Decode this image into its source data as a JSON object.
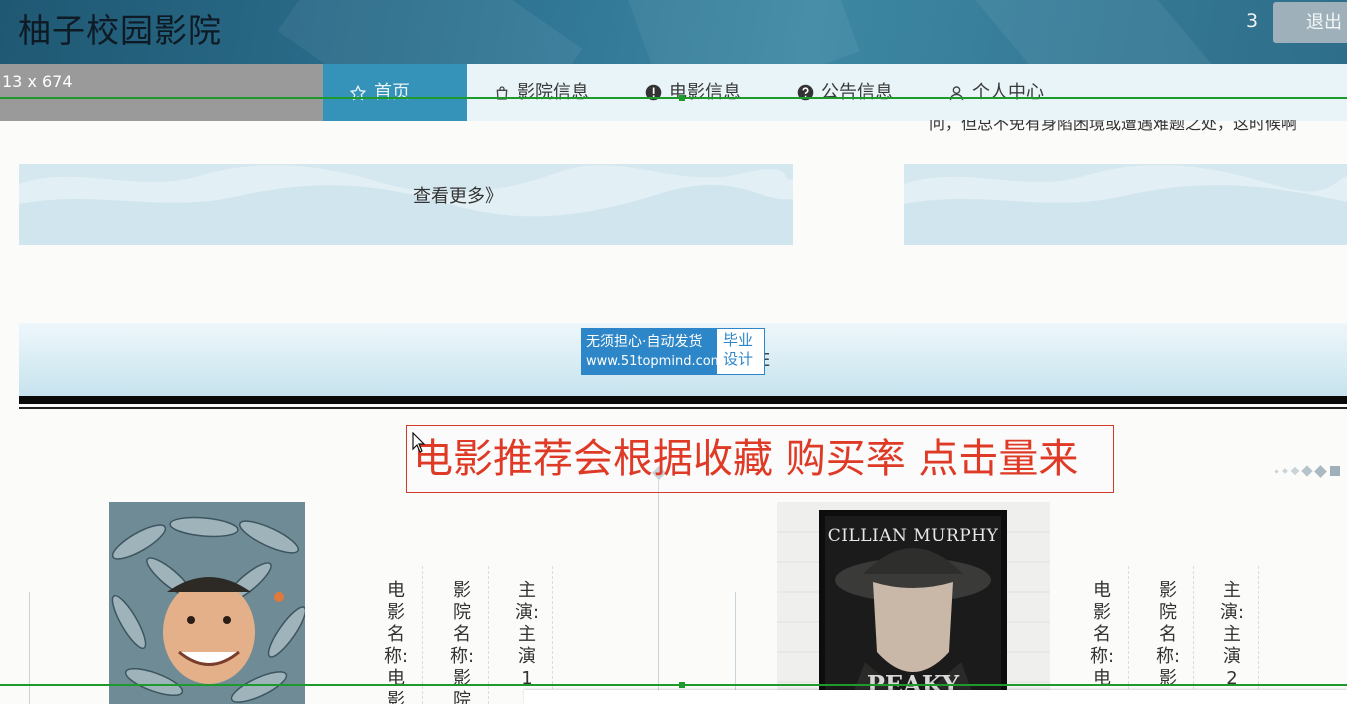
{
  "header": {
    "site_title": "柚子校园影院",
    "user_number": "3",
    "logout_label": "退出"
  },
  "overlay": {
    "size_label": "13 x 674"
  },
  "nav": {
    "items": [
      {
        "label": "首页",
        "icon": "star-icon",
        "active": true
      },
      {
        "label": "影院信息",
        "icon": "bag-icon",
        "active": false
      },
      {
        "label": "电影信息",
        "icon": "alert-icon",
        "active": false
      },
      {
        "label": "公告信息",
        "icon": "question-icon",
        "active": false
      },
      {
        "label": "个人中心",
        "icon": "user-icon",
        "active": false
      }
    ]
  },
  "notice": {
    "snippet": "问，但总不免有身陷困境或遭遇难题之处，这时候啊"
  },
  "more_label": "查看更多》",
  "ad": {
    "line1": "无须担心·自动发货",
    "line2": "www.51topmind.com",
    "tag1": "毕业",
    "tag2": "设计",
    "tail": "E"
  },
  "recommend_note": "电影推荐会根据收藏 购买率 点击量来",
  "movies": [
    {
      "poster_icon": "fish-poster-image",
      "poster_caption": "",
      "name_label": "电影名称:电影",
      "cinema_label": "影院名称:影院",
      "actor_label": "主演:主演1"
    },
    {
      "poster_icon": "cillian-poster-image",
      "poster_caption": "CILLIAN MURPHY",
      "poster_bottom": "PEAKY",
      "name_label": "电影名称:电",
      "cinema_label": "影院名称:影",
      "actor_label": "主演:主演2"
    }
  ],
  "colors": {
    "header_bg": "#2d7291",
    "nav_active": "#3592b8",
    "nav_bg": "#9a9a9a",
    "note_red": "#de3a26",
    "guide_green": "#1e9a2c"
  }
}
